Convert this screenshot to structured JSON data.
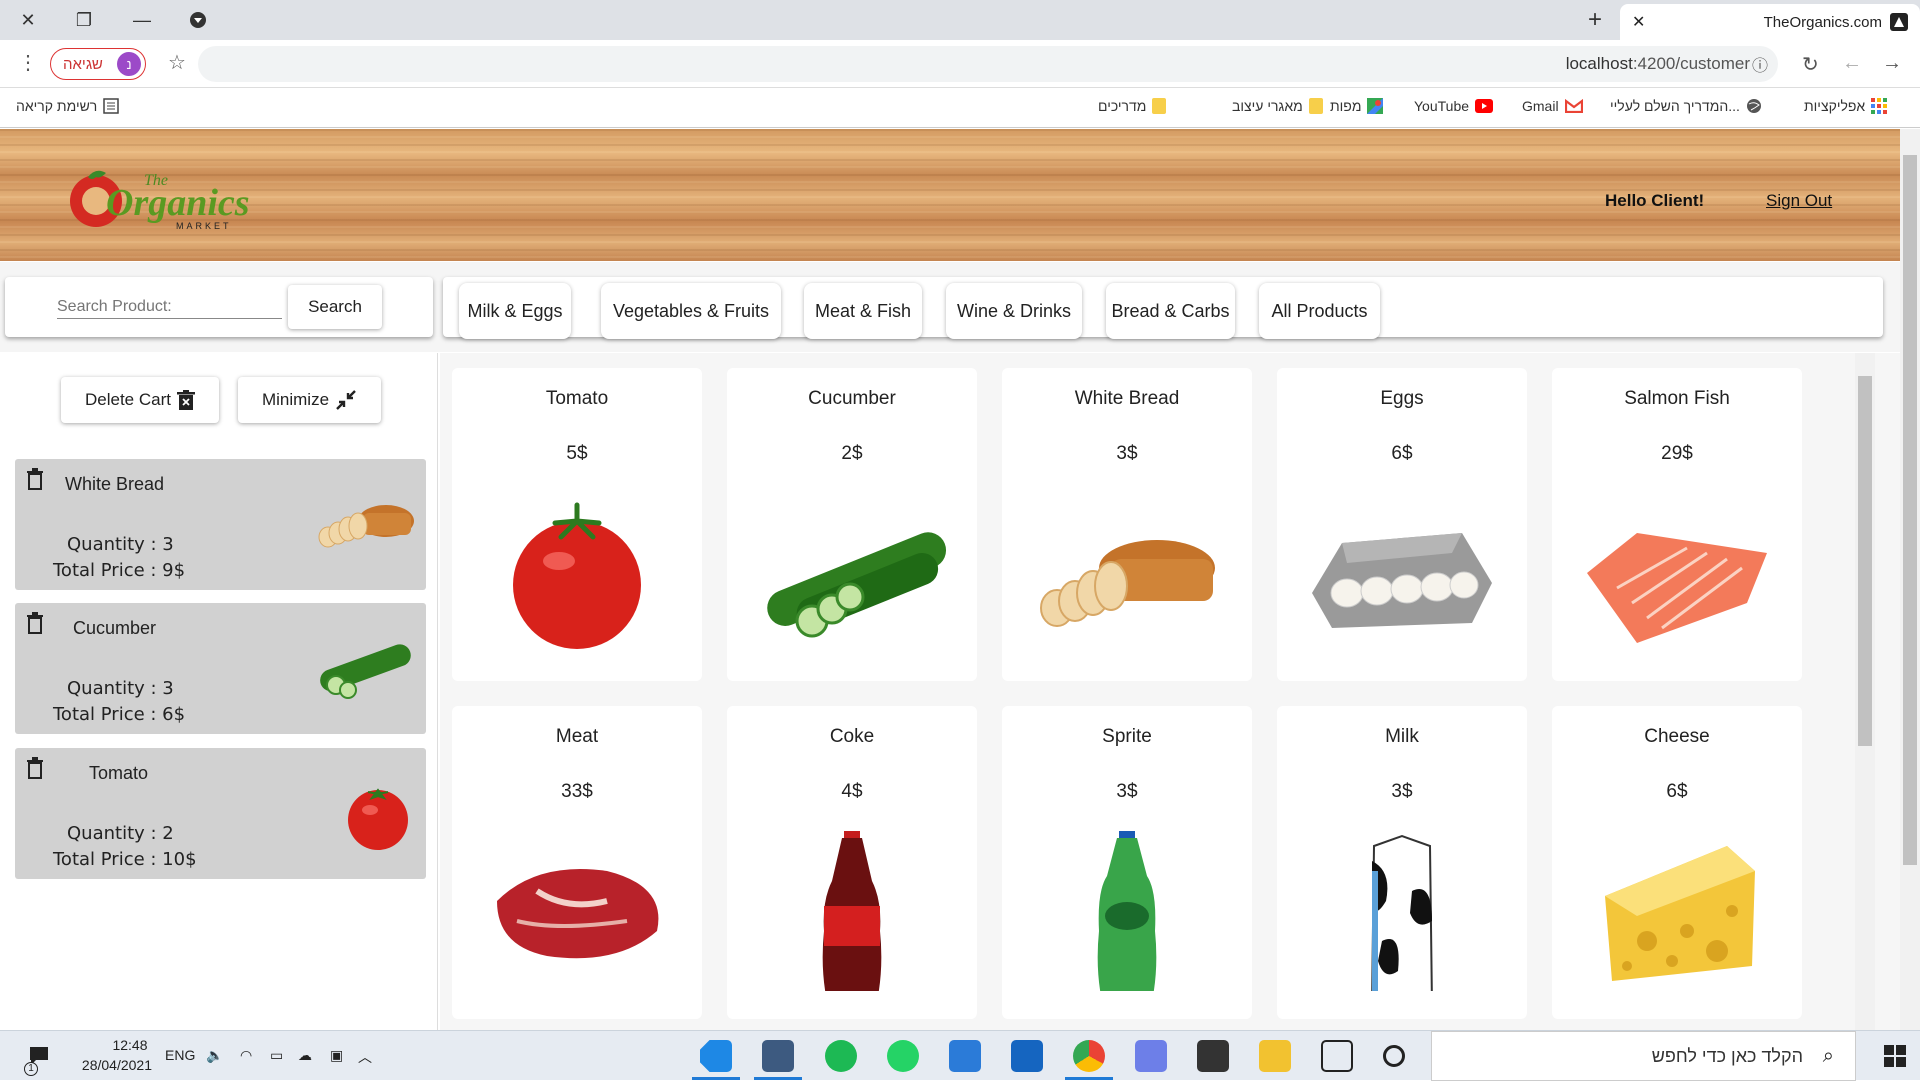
{
  "browser": {
    "tab_title": "TheOrganics.com",
    "url_host": "localhost",
    "url_path": ":4200/customer",
    "profile_label": "שגיאה",
    "profile_initial": "נ",
    "bookmarks": [
      {
        "label": "אפליקציות",
        "icon": "apps-grid-icon"
      },
      {
        "label": "המדריך השלם לעליי...",
        "icon": "globe-icon"
      },
      {
        "label": "Gmail",
        "icon": "gmail-icon"
      },
      {
        "label": "YouTube",
        "icon": "youtube-icon"
      },
      {
        "label": "מפות",
        "icon": "maps-icon"
      },
      {
        "label": "מאגרי עיצוב",
        "icon": "folder-icon"
      },
      {
        "label": "מדריכים",
        "icon": "folder-icon"
      }
    ],
    "reading_list": "רשימת קריאה"
  },
  "header": {
    "logo_top": "The",
    "logo_main": "Organics",
    "logo_sub": "MARKET",
    "greeting": "Hello Client!",
    "sign_out": "Sign Out"
  },
  "search": {
    "placeholder": "Search Product:",
    "button": "Search"
  },
  "categories": [
    "Milk & Eggs",
    "Vegetables & Fruits",
    "Meat & Fish",
    "Wine & Drinks",
    "Bread & Carbs",
    "All Products"
  ],
  "cart": {
    "delete_label": "Delete Cart",
    "minimize_label": "Minimize",
    "items": [
      {
        "name": "White Bread",
        "quantity": "Quantity : 3",
        "total": "Total Price : 9$",
        "image": "bread"
      },
      {
        "name": "Cucumber",
        "quantity": "Quantity : 3",
        "total": "Total Price : 6$",
        "image": "cucumber"
      },
      {
        "name": "Tomato",
        "quantity": "Quantity : 2",
        "total": "Total Price : 10$",
        "image": "tomato"
      }
    ]
  },
  "products": [
    {
      "name": "Tomato",
      "price": "5$",
      "image": "tomato"
    },
    {
      "name": "Cucumber",
      "price": "2$",
      "image": "cucumber"
    },
    {
      "name": "White Bread",
      "price": "3$",
      "image": "bread"
    },
    {
      "name": "Eggs",
      "price": "6$",
      "image": "eggs"
    },
    {
      "name": "Salmon Fish",
      "price": "29$",
      "image": "salmon"
    },
    {
      "name": "Meat",
      "price": "33$",
      "image": "meat"
    },
    {
      "name": "Coke",
      "price": "4$",
      "image": "coke"
    },
    {
      "name": "Sprite",
      "price": "3$",
      "image": "sprite"
    },
    {
      "name": "Milk",
      "price": "3$",
      "image": "milk"
    },
    {
      "name": "Cheese",
      "price": "6$",
      "image": "cheese"
    }
  ],
  "taskbar": {
    "search_placeholder": "הקלד כאן כדי לחפש",
    "time": "12:48",
    "date": "28/04/2021",
    "lang": "ENG",
    "notif_count": "1"
  }
}
